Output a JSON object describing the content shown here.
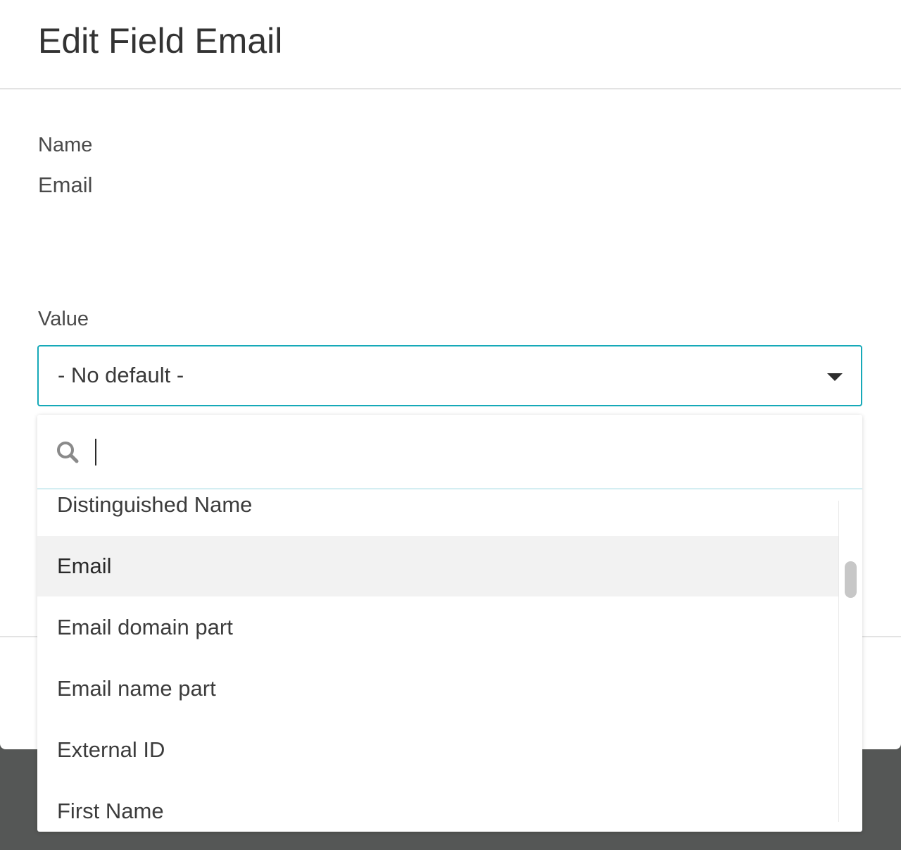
{
  "modal": {
    "title": "Edit Field Email"
  },
  "name_field": {
    "label": "Name",
    "value": "Email"
  },
  "value_field": {
    "label": "Value",
    "selected": "- No default -"
  },
  "dropdown": {
    "search_value": "",
    "options": [
      {
        "label": "Distinguished Name",
        "highlighted": false
      },
      {
        "label": "Email",
        "highlighted": true
      },
      {
        "label": "Email domain part",
        "highlighted": false
      },
      {
        "label": "Email name part",
        "highlighted": false
      },
      {
        "label": "External ID",
        "highlighted": false
      },
      {
        "label": "First Name",
        "highlighted": false
      }
    ]
  },
  "colors": {
    "accent": "#16a9b8",
    "backdrop": "#555756",
    "highlight": "#f2f2f2"
  },
  "icons": {
    "search": "search-icon",
    "caret": "chevron-down-icon"
  }
}
